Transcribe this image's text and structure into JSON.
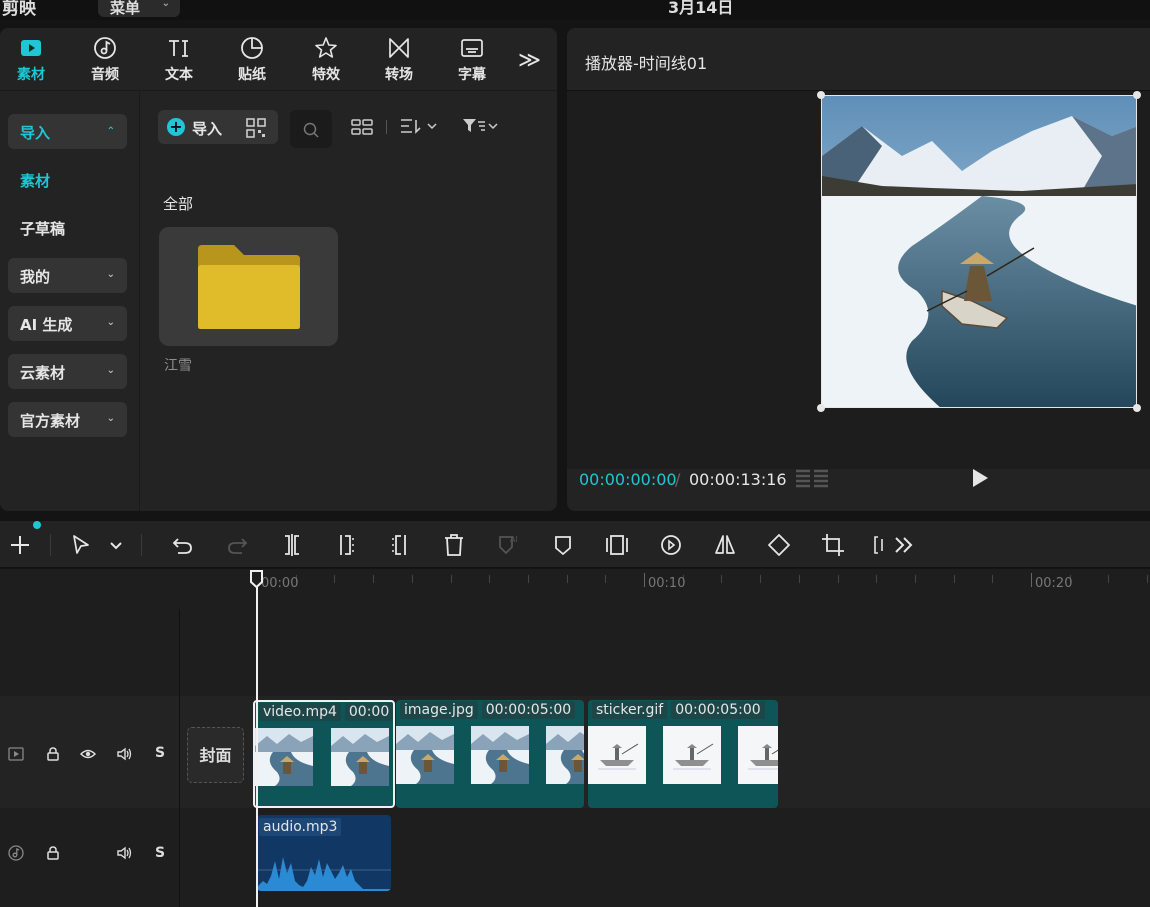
{
  "app": {
    "name": "剪映",
    "menu_label": "菜单",
    "date": "3月14日"
  },
  "tool_tabs": [
    {
      "label": "素材",
      "icon": "media-play-icon",
      "active": true
    },
    {
      "label": "音频",
      "icon": "audio-note-icon"
    },
    {
      "label": "文本",
      "icon": "text-ti-icon"
    },
    {
      "label": "贴纸",
      "icon": "sticker-icon"
    },
    {
      "label": "特效",
      "icon": "effects-star-icon"
    },
    {
      "label": "转场",
      "icon": "transition-icon"
    },
    {
      "label": "字幕",
      "icon": "subtitle-icon"
    }
  ],
  "more_tabs_glyph": "≫",
  "side_nav": [
    {
      "label": "导入",
      "boxed": true,
      "cyan": true,
      "chevron": "⌃"
    },
    {
      "label": "素材",
      "cyan": true
    },
    {
      "label": "子草稿"
    },
    {
      "label": "我的",
      "boxed": true,
      "chevron": "⌄"
    },
    {
      "label": "AI 生成",
      "boxed": true,
      "chevron": "⌄"
    },
    {
      "label": "云素材",
      "boxed": true,
      "chevron": "⌄"
    },
    {
      "label": "官方素材",
      "boxed": true,
      "chevron": "⌄"
    }
  ],
  "media": {
    "import_label": "导入",
    "section_title": "全部",
    "folder_name": "江雪",
    "folder_color": "#e0bc2a"
  },
  "player": {
    "title": "播放器-时间线01",
    "time_current": "00:00:00:00",
    "time_separator": "/",
    "time_total": "00:00:13:16"
  },
  "timeline": {
    "ruler_labels": [
      "00:00",
      "00:10",
      "00:20"
    ],
    "cover_label": "封面",
    "main_track_clips": [
      {
        "name": "video.mp4",
        "duration": "00:00"
      },
      {
        "name": "image.jpg",
        "duration": "00:00:05:00"
      },
      {
        "name": "sticker.gif",
        "duration": "00:00:05:00"
      }
    ],
    "audio_clip": {
      "name": "audio.mp3"
    },
    "track_solo_label": "S"
  },
  "colors": {
    "accent": "#1fc6d6",
    "video_clip": "#0e5558",
    "audio_clip": "#113765",
    "panel_bg": "#232323"
  }
}
